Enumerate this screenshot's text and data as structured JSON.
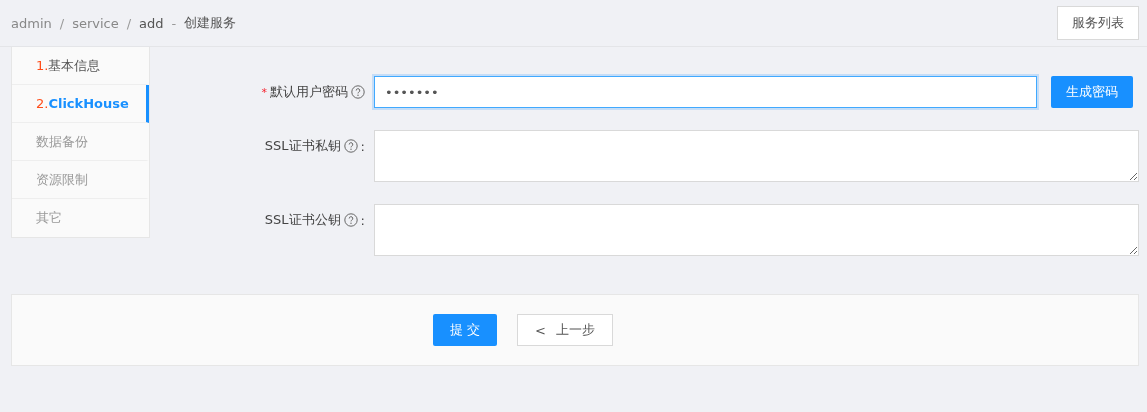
{
  "breadcrumb": {
    "items": [
      "admin",
      "service",
      "add"
    ],
    "separator": "/",
    "dash": "-",
    "title": "创建服务"
  },
  "list_button": "服务列表",
  "steps": [
    {
      "number": "1.",
      "label": "基本信息",
      "selected": false,
      "disabled": false
    },
    {
      "number": "2.",
      "label": "ClickHouse",
      "selected": true,
      "disabled": false
    },
    {
      "label": "数据备份",
      "selected": false,
      "disabled": true
    },
    {
      "label": "资源限制",
      "selected": false,
      "disabled": true
    },
    {
      "label": "其它",
      "selected": false,
      "disabled": true
    }
  ],
  "form": {
    "fields": [
      {
        "kind": "password",
        "required_mark": "*",
        "label": "默认用户密码",
        "value": "•••••••",
        "focused": true,
        "button": "生成密码"
      },
      {
        "kind": "textarea",
        "label": "SSL证书私钥",
        "colon": ":",
        "focused": false
      },
      {
        "kind": "textarea",
        "label": "SSL证书公钥",
        "colon": ":",
        "focused": false
      }
    ]
  },
  "footer": {
    "submit": "提 交",
    "back_caret": "<",
    "back": "上一步"
  }
}
